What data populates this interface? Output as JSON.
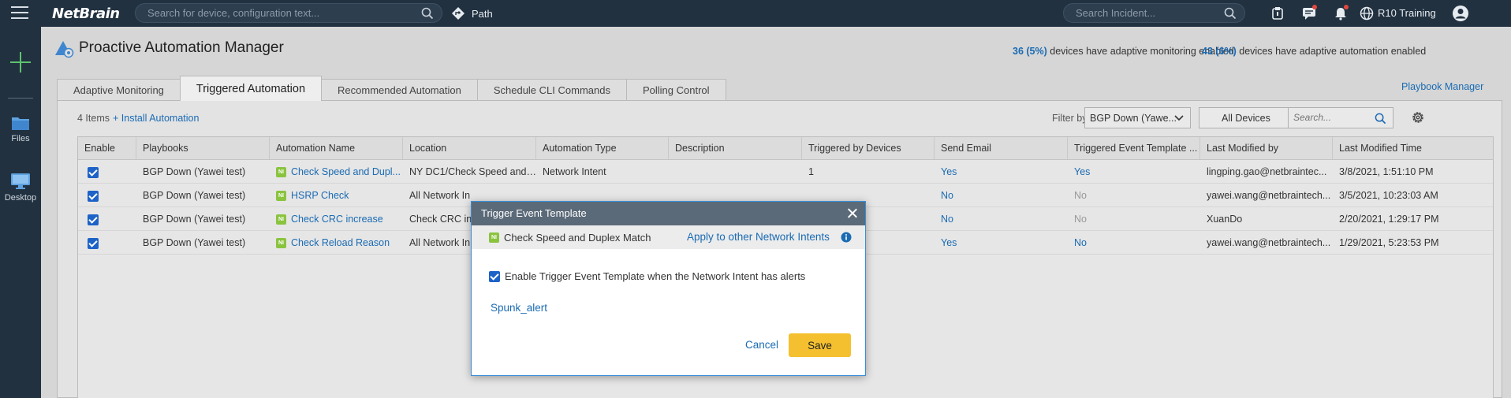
{
  "topbar": {
    "brand": "NetBrain",
    "search_placeholder": "Search for device, configuration text...",
    "path_label": "Path",
    "incident_placeholder": "Search Incident...",
    "domain_label": "R10 Training"
  },
  "leftrail": {
    "files_label": "Files",
    "desktop_label": "Desktop"
  },
  "page": {
    "title": "Proactive Automation Manager",
    "monitor_count": "36 (5%)",
    "monitor_text": " devices have adaptive monitoring enabled",
    "automation_count": "43 (6%)",
    "automation_text": " devices have adaptive automation enabled",
    "playbook_link": "Playbook Manager"
  },
  "tabs": [
    {
      "label": "Adaptive Monitoring"
    },
    {
      "label": "Triggered Automation"
    },
    {
      "label": "Recommended Automation"
    },
    {
      "label": "Schedule CLI Commands"
    },
    {
      "label": "Polling Control"
    }
  ],
  "toolbar": {
    "items_count": "4 Items",
    "install_link": "+ Install Automation",
    "filter_label": "Filter by:",
    "filter_value": "BGP Down (Yawe...",
    "devices_value": "All Devices",
    "search_placeholder": "Search..."
  },
  "table": {
    "headers": [
      "Enable",
      "Playbooks",
      "Automation Name",
      "Location",
      "Automation Type",
      "Description",
      "Triggered by Devices",
      "Send Email",
      "Triggered Event Template ...",
      "Last Modified by",
      "Last Modified Time"
    ],
    "rows": [
      {
        "playbook": "BGP Down (Yawei test)",
        "name": "Check Speed and Dupl...",
        "location": "NY DC1/Check Speed and ...",
        "type": "Network Intent",
        "description": "",
        "devices": "1",
        "email": "Yes",
        "template": "Yes",
        "modified_by": "lingping.gao@netbraintec...",
        "modified_time": "3/8/2021, 1:51:10 PM"
      },
      {
        "playbook": "BGP Down (Yawei test)",
        "name": "HSRP Check",
        "location": "All Network In",
        "type": "",
        "description": "",
        "devices": "",
        "email": "No",
        "template": "No",
        "modified_by": "yawei.wang@netbraintech...",
        "modified_time": "3/5/2021, 10:23:03 AM"
      },
      {
        "playbook": "BGP Down (Yawei test)",
        "name": "Check CRC increase",
        "location": "Check CRC in",
        "type": "",
        "description": "",
        "devices": "",
        "email": "No",
        "template": "No",
        "modified_by": "XuanDo",
        "modified_time": "2/20/2021, 1:29:17 PM"
      },
      {
        "playbook": "BGP Down (Yawei test)",
        "name": "Check Reload Reason",
        "location": "All Network In",
        "type": "",
        "description": "",
        "devices": "",
        "email": "Yes",
        "template": "No",
        "modified_by": "yawei.wang@netbraintech...",
        "modified_time": "1/29/2021, 5:23:53 PM"
      }
    ]
  },
  "modal": {
    "title": "Trigger Event Template",
    "intent_name": "Check Speed and Duplex Match",
    "apply_link": "Apply to other Network Intents",
    "enable_label": "Enable Trigger Event Template when the Network Intent has alerts",
    "template_link": "Spunk_alert",
    "cancel_label": "Cancel",
    "save_label": "Save"
  },
  "badge": {
    "ni": "NI"
  },
  "colors": {
    "topbar": "#213140",
    "link": "#1a6bb3",
    "save_button": "#f5c02f",
    "checkbox": "#1d62c7",
    "ni_badge": "#8ac43f",
    "plus_icon": "#5ec36e"
  },
  "icons": [
    "menu-icon",
    "search-icon",
    "path-icon",
    "incident-icon",
    "chat-icon",
    "bell-icon",
    "globe-icon",
    "user-icon",
    "plus-icon",
    "folder-icon",
    "desktop-icon",
    "settings-icon",
    "info-icon",
    "close-icon"
  ]
}
